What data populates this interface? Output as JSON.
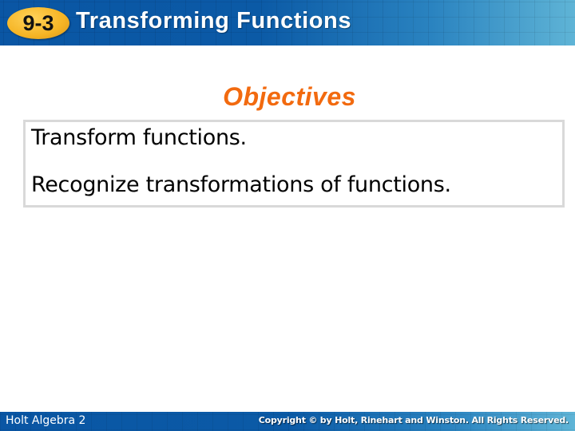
{
  "header": {
    "lesson_badge": "9-3",
    "title": "Transforming Functions"
  },
  "main": {
    "heading": "Objectives",
    "objectives": [
      "Transform functions.",
      "Recognize transformations of functions."
    ]
  },
  "footer": {
    "left_text": "Holt Algebra 2",
    "copyright": "Copyright © by Holt, Rinehart and Winston. All Rights Reserved."
  },
  "colors": {
    "header_blue": "#0b5aa6",
    "header_light_blue": "#5fb4d6",
    "badge_gold": "#f5b424",
    "heading_orange": "#f26a0f",
    "box_border": "#d9d9d9"
  }
}
